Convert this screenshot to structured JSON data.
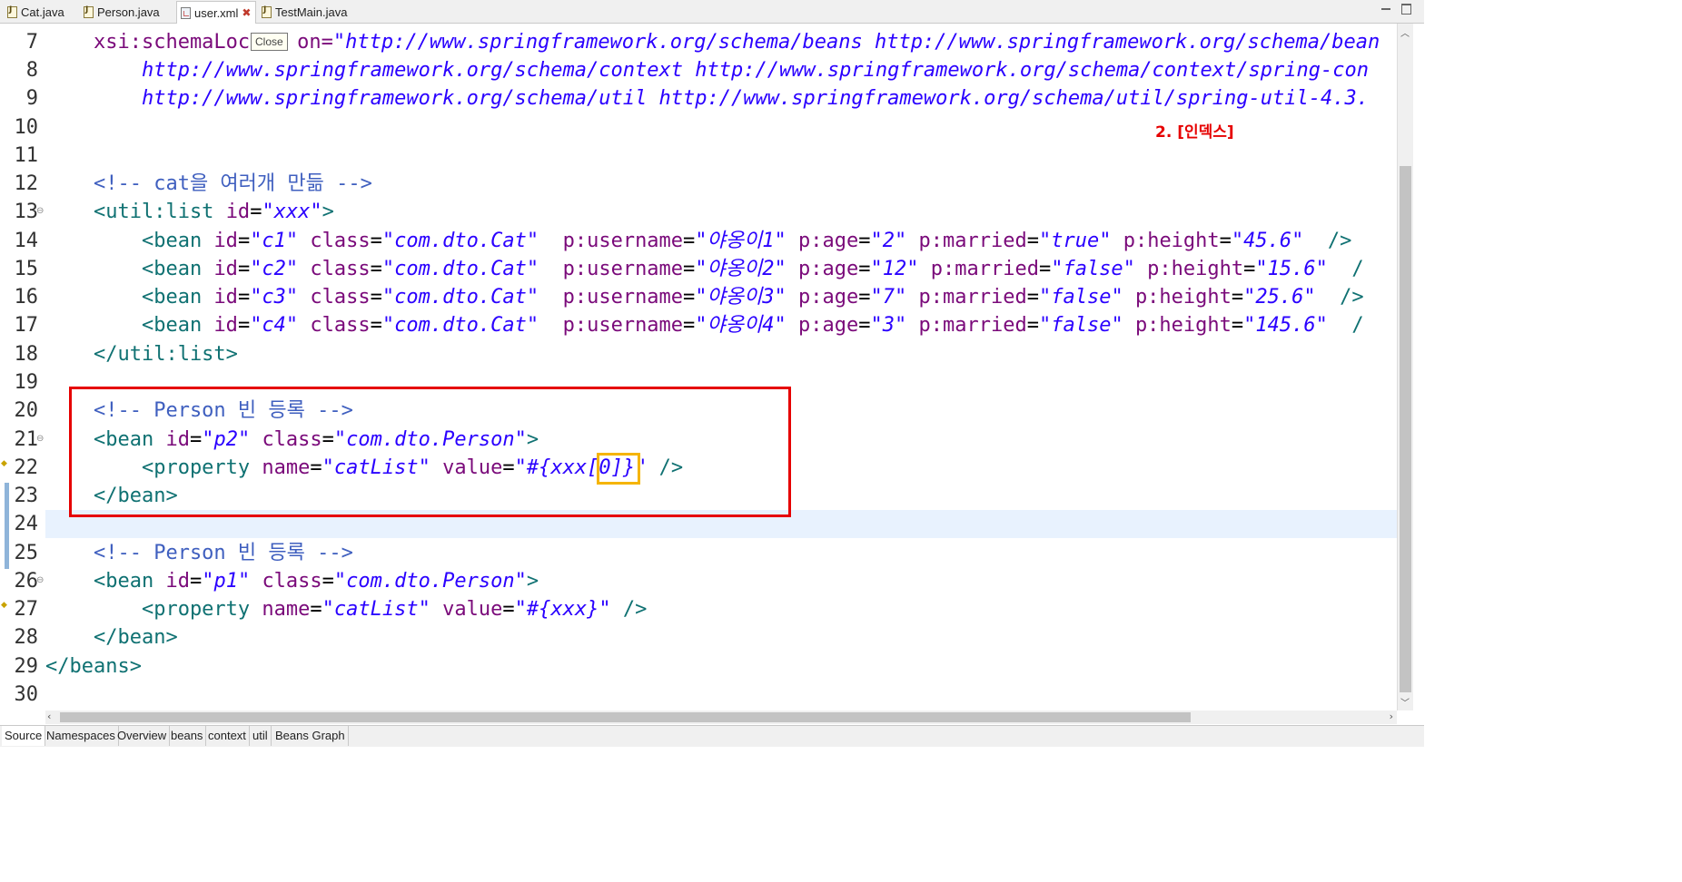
{
  "tabs": [
    {
      "label": "Cat.java",
      "type": "java"
    },
    {
      "label": "Person.java",
      "type": "java"
    },
    {
      "label": "user.xml",
      "type": "xml"
    },
    {
      "label": "TestMain.java",
      "type": "java"
    }
  ],
  "tooltip": "Close",
  "annotation": "2. [인덱스]",
  "line_numbers": [
    "7",
    "8",
    "9",
    "10",
    "11",
    "12",
    "13",
    "14",
    "15",
    "16",
    "17",
    "18",
    "19",
    "20",
    "21",
    "22",
    "23",
    "24",
    "25",
    "26",
    "27",
    "28",
    "29",
    "30"
  ],
  "code": {
    "l7a": "    xsi:schemaLoc",
    "l7b": "on=",
    "l7c": "\"http://www.springframework.org/schema/beans http://www.springframework.org/schema/bean",
    "l8": "        http://www.springframework.org/schema/context http://www.springframework.org/schema/context/spring-con",
    "l9": "        http://www.springframework.org/schema/util http://www.springframework.org/schema/util/spring-util-4.3.",
    "l12": "    <!-- cat을 여러개 만듦 -->",
    "l13a": "    <util:list ",
    "l13b": "id",
    "l13c": "=",
    "l13d": "\"xxx\"",
    "l13e": ">",
    "beans": [
      {
        "id": "\"c1\"",
        "cls": "\"com.dto.Cat\"",
        "name": "\"야옹이1\"",
        "age": "\"2\"",
        "married": "\"true\"",
        "height": "\"45.6\"",
        "end": "  />"
      },
      {
        "id": "\"c2\"",
        "cls": "\"com.dto.Cat\"",
        "name": "\"야옹이2\"",
        "age": "\"12\"",
        "married": "\"false\"",
        "height": "\"15.6\"",
        "end": "  /"
      },
      {
        "id": "\"c3\"",
        "cls": "\"com.dto.Cat\"",
        "name": "\"야옹이3\"",
        "age": "\"7\"",
        "married": "\"false\"",
        "height": "\"25.6\"",
        "end": "  />"
      },
      {
        "id": "\"c4\"",
        "cls": "\"com.dto.Cat\"",
        "name": "\"야옹이4\"",
        "age": "\"3\"",
        "married": "\"false\"",
        "height": "\"145.6\"",
        "end": "  /"
      }
    ],
    "l18": "    </util:list>",
    "l20": "    <!-- Person 빈 등록 -->",
    "l21": {
      "id": "\"p2\"",
      "cls": "\"com.dto.Person\""
    },
    "l22": {
      "name": "\"catList\"",
      "value_a": "\"#{xxx",
      "value_b": "[0]",
      "value_c": "}\""
    },
    "l23": "    </bean>",
    "l25": "    <!-- Person 빈 등록 -->",
    "l26": {
      "id": "\"p1\"",
      "cls": "\"com.dto.Person\""
    },
    "l27": {
      "name": "\"catList\"",
      "value": "\"#{xxx}\""
    },
    "l28": "    </bean>",
    "l29": "</beans>"
  },
  "bottom_tabs": [
    "Source",
    "Namespaces",
    "Overview",
    "beans",
    "context",
    "util",
    "Beans Graph"
  ],
  "colors": {
    "tag": "#0f7172",
    "attr": "#7a0a7a",
    "value": "#2a00ff",
    "comment": "#3f5fbf",
    "highlight_box": "#e60000",
    "index_box": "#f5b400"
  }
}
